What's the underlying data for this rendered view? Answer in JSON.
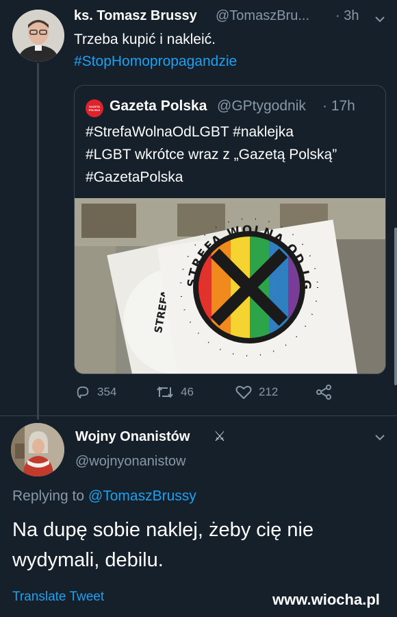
{
  "tweet1": {
    "name": "ks. Tomasz Brussy",
    "handle": "@TomaszBru...",
    "time": "· 3h",
    "text": "Trzeba kupić i nakleić.",
    "hashtag": "#StopHomopropagandzie"
  },
  "quote": {
    "name": "Gazeta Polska",
    "handle": "@GPtygodnik",
    "time": "· 17h",
    "badge": "GAZETA POLSKA",
    "lines": [
      "#StrefaWolnaOdLGBT #naklejka",
      "#LGBT wkrótce wraz z „Gazetą Polską”",
      "#GazetaPolska"
    ],
    "sticker_text_front": "STREFA WOLNA OD LGBT",
    "sticker_text_back": "STREFA"
  },
  "actions": {
    "replies": "354",
    "retweets": "46",
    "likes": "212"
  },
  "tweet2": {
    "name": "Wojny Onanistów",
    "emoji": "⚔",
    "handle": "@wojnyonanistow",
    "replying_prefix": "Replying to",
    "replying_to": "@TomaszBrussy",
    "text_line1": "Na dupę sobie naklej, żeby cię nie",
    "text_line2": "wydymali, debilu.",
    "translate": "Translate Tweet"
  },
  "watermark": "www.wiocha.pl",
  "colors": {
    "background": "#15202b",
    "accent": "#1da1f2",
    "muted": "#8899a6",
    "border": "#38444d"
  }
}
